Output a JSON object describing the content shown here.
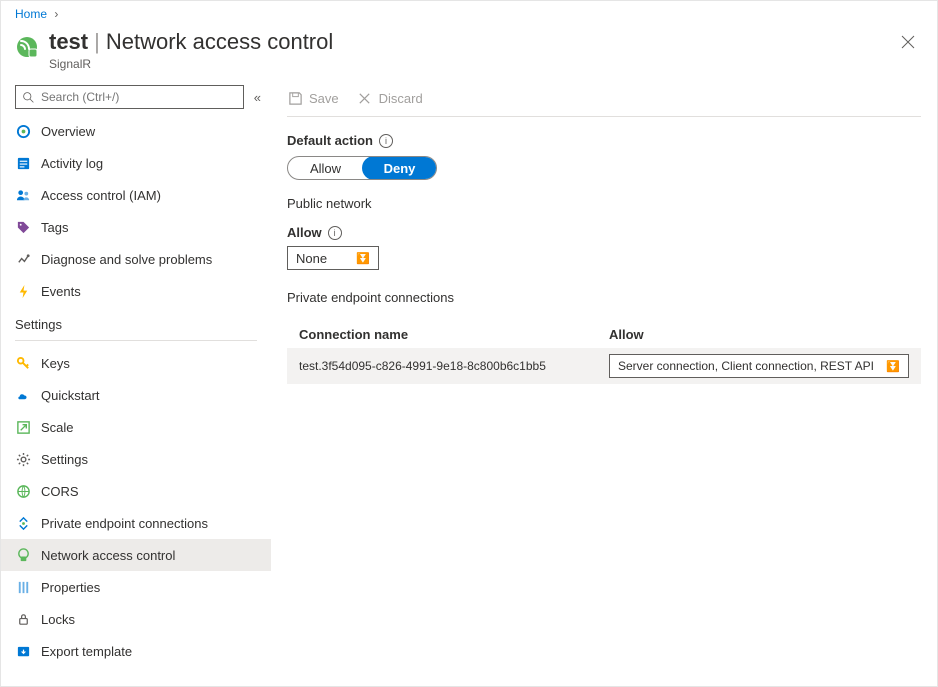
{
  "breadcrumb": {
    "home": "Home"
  },
  "header": {
    "resource_name": "test",
    "page_title": "Network access control",
    "resource_type": "SignalR"
  },
  "search": {
    "placeholder": "Search (Ctrl+/)"
  },
  "nav": {
    "top": {
      "overview": "Overview",
      "activity_log": "Activity log",
      "access_control": "Access control (IAM)",
      "tags": "Tags",
      "diagnose": "Diagnose and solve problems",
      "events": "Events"
    },
    "section_settings": "Settings",
    "settings": {
      "keys": "Keys",
      "quickstart": "Quickstart",
      "scale": "Scale",
      "settings": "Settings",
      "cors": "CORS",
      "private_endpoint": "Private endpoint connections",
      "network_access": "Network access control",
      "properties": "Properties",
      "locks": "Locks",
      "export_template": "Export template"
    }
  },
  "commands": {
    "save": "Save",
    "discard": "Discard"
  },
  "default_action": {
    "label": "Default action",
    "allow": "Allow",
    "deny": "Deny"
  },
  "public_network": {
    "heading": "Public network",
    "allow_label": "Allow",
    "selected": "None"
  },
  "private_endpoint": {
    "heading": "Private endpoint connections",
    "col_connection": "Connection name",
    "col_allow": "Allow",
    "rows": [
      {
        "name": "test.3f54d095-c826-4991-9e18-8c800b6c1bb5",
        "allow": "Server connection, Client connection, REST API"
      }
    ]
  }
}
